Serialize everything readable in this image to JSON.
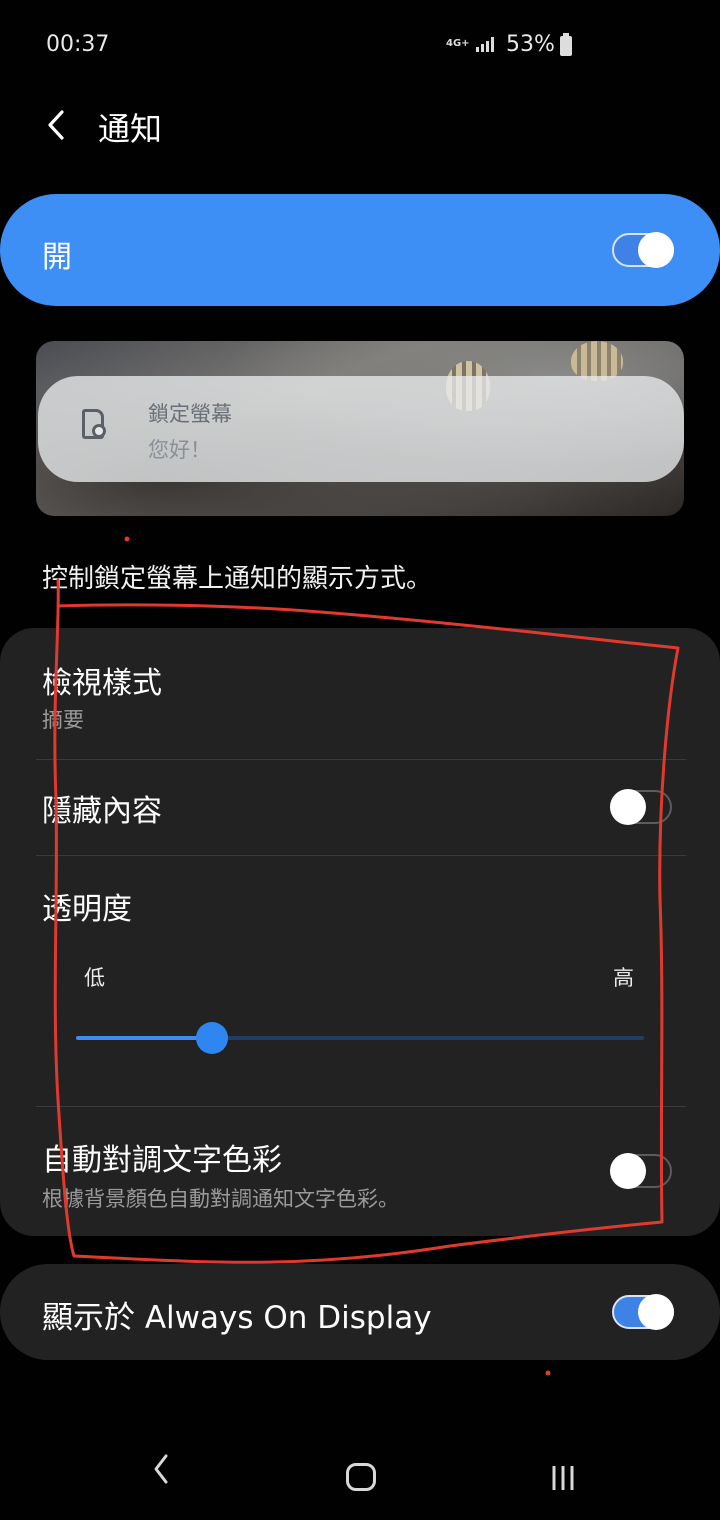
{
  "status_bar": {
    "time": "00:37",
    "network": "4G+",
    "battery": "53%",
    "icons": [
      "signal-icon",
      "battery-icon"
    ]
  },
  "header": {
    "title": "通知",
    "back_icon": "chevron-left-icon"
  },
  "master_switch": {
    "label": "開",
    "on": true
  },
  "preview": {
    "card_title": "鎖定螢幕",
    "card_subtitle": "您好！",
    "icon": "settings-document-icon"
  },
  "description": "控制鎖定螢幕上通知的顯示方式。",
  "settings": {
    "view_style": {
      "title": "檢視樣式",
      "value": "摘要"
    },
    "hide_content": {
      "title": "隱藏內容",
      "on": false
    },
    "transparency": {
      "title": "透明度",
      "low_label": "低",
      "high_label": "高",
      "value_fraction": 0.24
    },
    "auto_reverse": {
      "title": "自動對調文字色彩",
      "subtitle": "根據背景顏色自動對調通知文字色彩。",
      "on": false
    }
  },
  "aod": {
    "label": "顯示於 Always On Display",
    "on": true
  },
  "nav_bar": {
    "icons": [
      "back-nav-icon",
      "home-nav-icon",
      "recents-nav-icon"
    ]
  },
  "colors": {
    "accent": "#3d8ff6",
    "panel": "#222222",
    "background": "#010101",
    "annotation": "#e03a2e"
  }
}
